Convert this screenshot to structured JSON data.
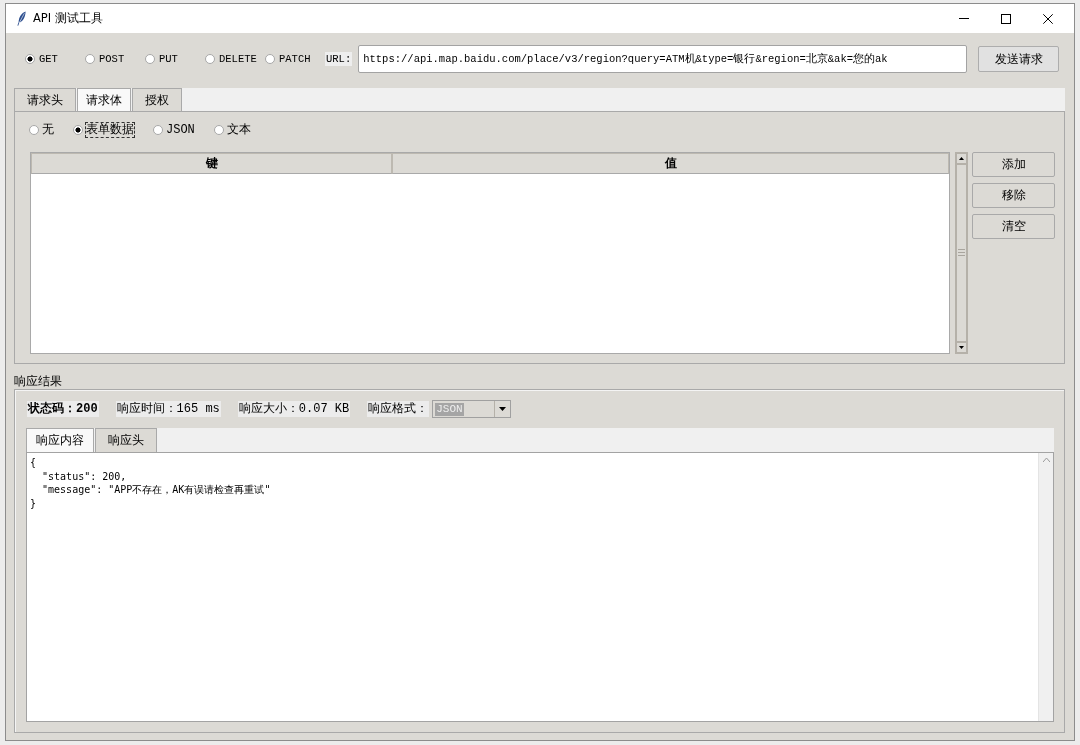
{
  "window": {
    "title": "API 测试工具"
  },
  "toolbar": {
    "methods": [
      {
        "label": "GET",
        "selected": true
      },
      {
        "label": "POST",
        "selected": false
      },
      {
        "label": "PUT",
        "selected": false
      },
      {
        "label": "DELETE",
        "selected": false
      },
      {
        "label": "PATCH",
        "selected": false
      }
    ],
    "url_label": "URL:",
    "url": "https://api.map.baidu.com/place/v3/region?query=ATM机&type=银行&region=北京&ak=您的ak",
    "send_button": "发送请求"
  },
  "request_tabs": [
    {
      "label": "请求头",
      "selected": false
    },
    {
      "label": "请求体",
      "selected": true
    },
    {
      "label": "授权",
      "selected": false
    }
  ],
  "body_types": [
    {
      "label": "无",
      "selected": false,
      "focused": false
    },
    {
      "label": "表单数据",
      "selected": true,
      "focused": true
    },
    {
      "label": "JSON",
      "selected": false,
      "focused": false
    },
    {
      "label": "文本",
      "selected": false,
      "focused": false
    }
  ],
  "params_table": {
    "columns": [
      "键",
      "值"
    ]
  },
  "table_buttons": [
    "添加",
    "移除",
    "清空"
  ],
  "response": {
    "title": "响应结果",
    "status_code": "状态码：200",
    "time": "响应时间：165 ms",
    "size": "响应大小：0.07 KB",
    "format": {
      "label": "响应格式：",
      "value": "JSON",
      "text_selected": true
    },
    "tabs": [
      {
        "label": "响应内容",
        "selected": true
      },
      {
        "label": "响应头",
        "selected": false
      }
    ],
    "body_lines": [
      "{",
      "  \"status\": 200,",
      "  \"message\": \"APP不存在，AK有误请检查再重试\"",
      "}"
    ]
  }
}
